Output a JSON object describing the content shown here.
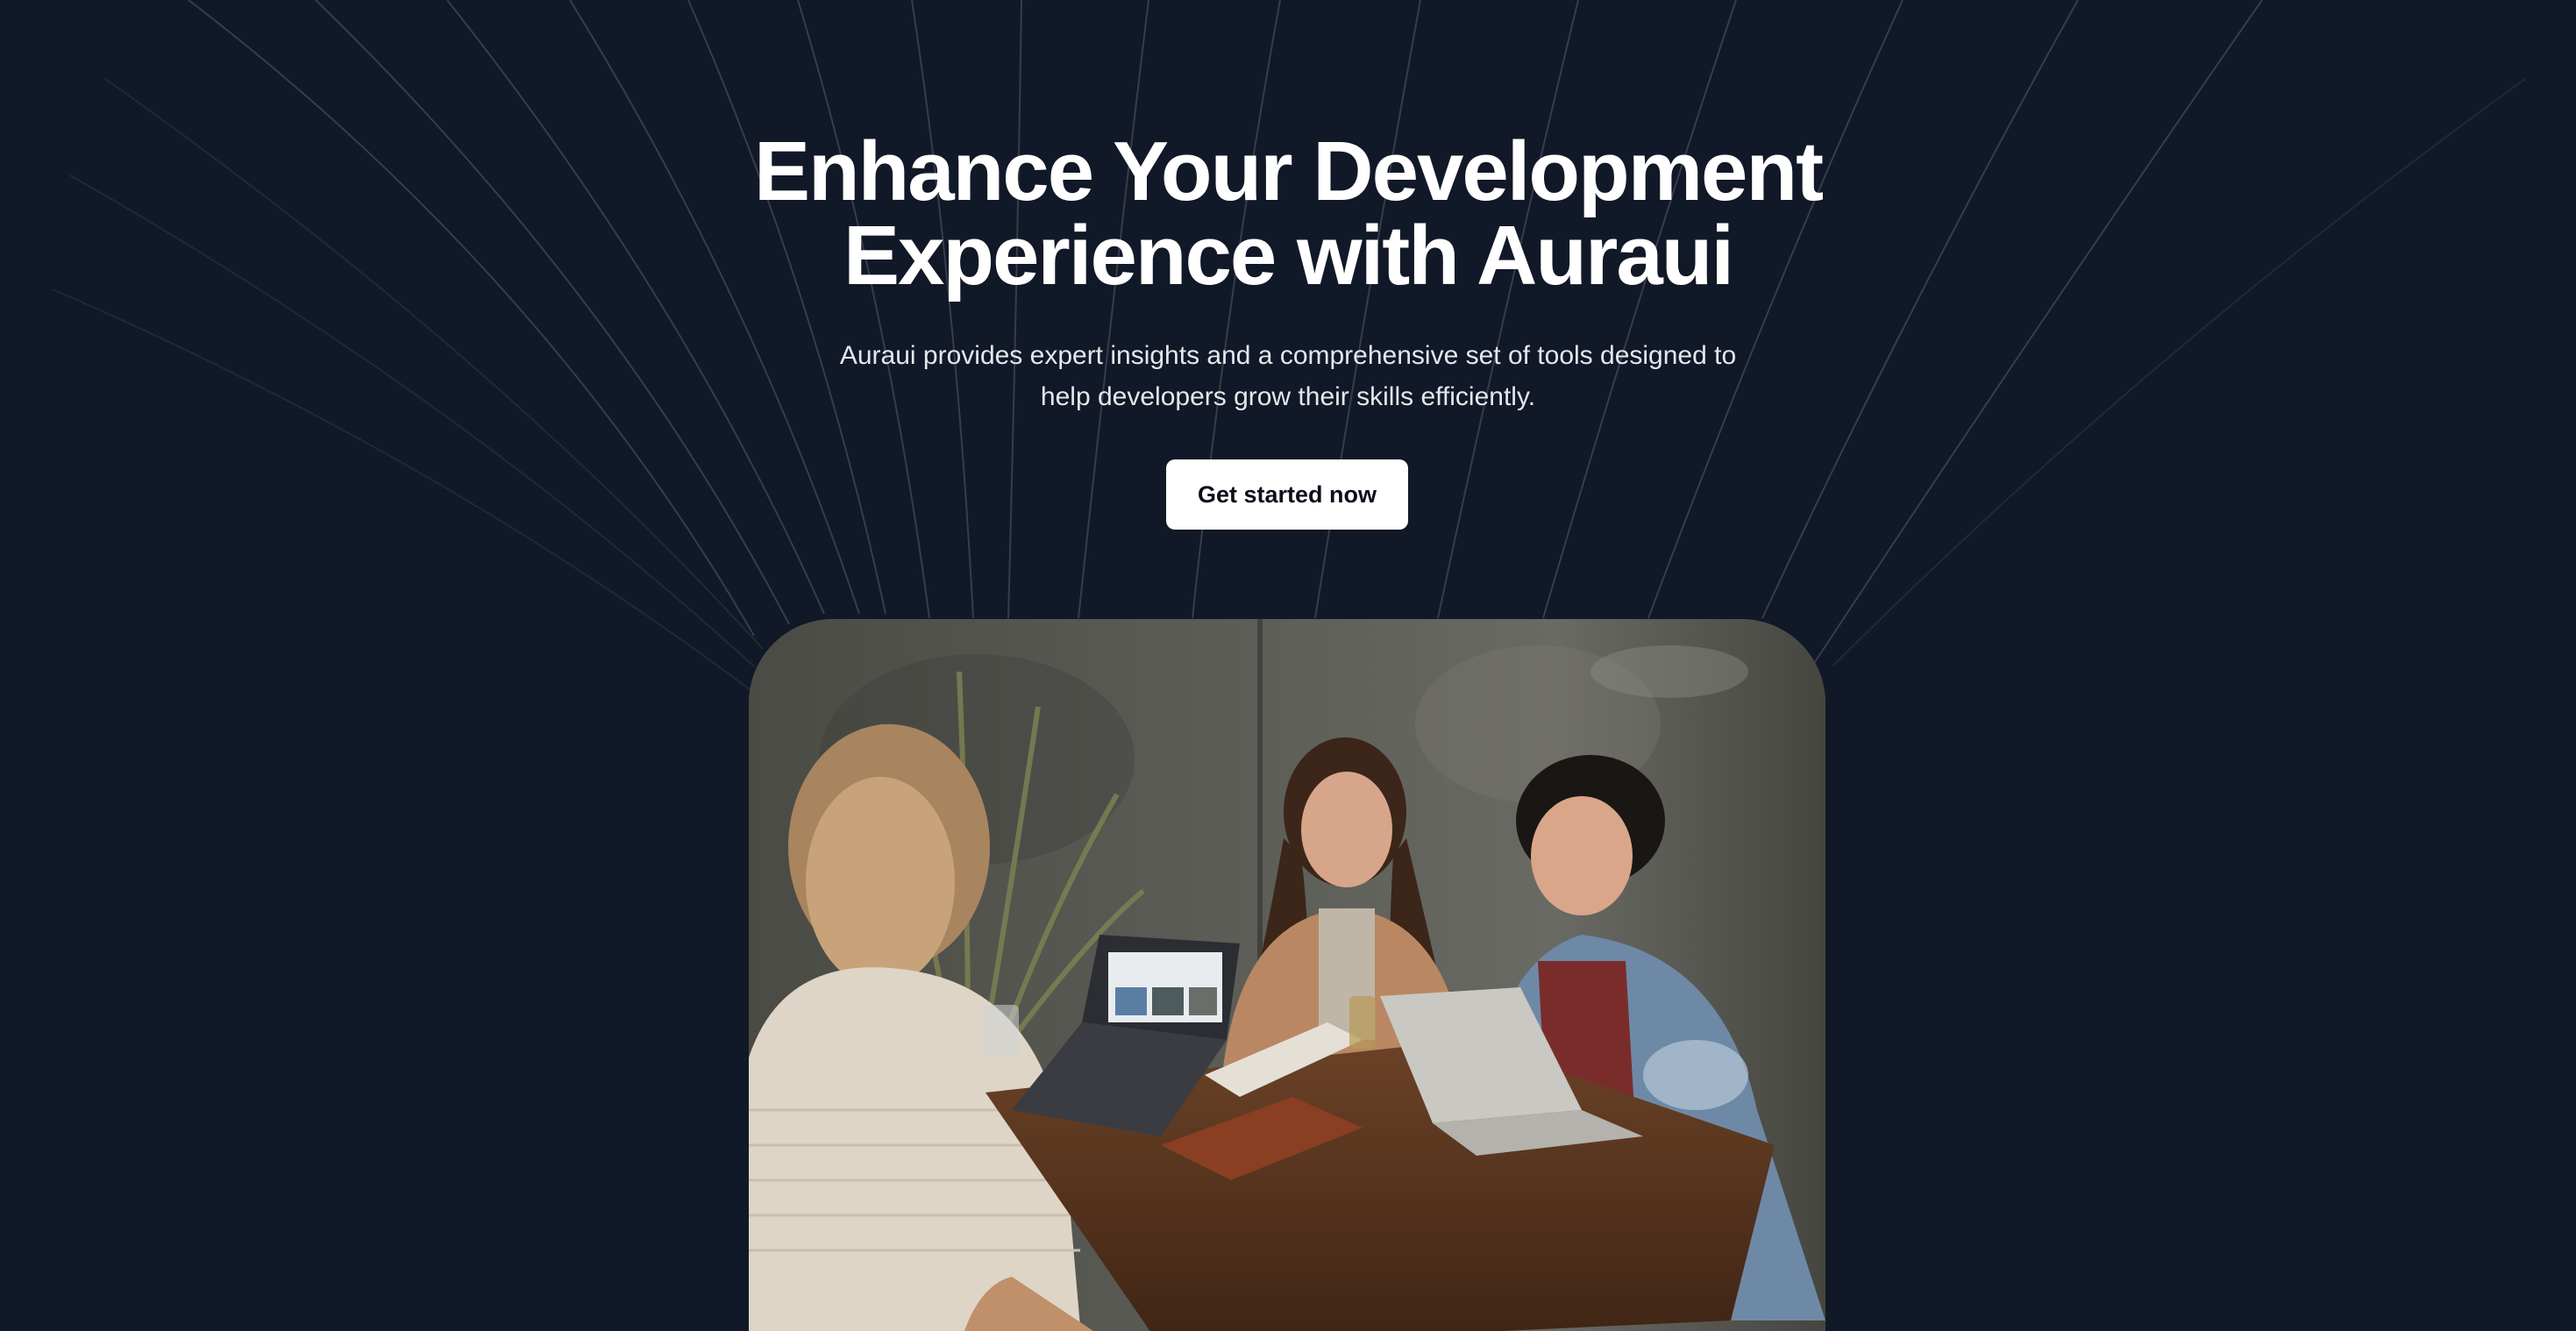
{
  "hero": {
    "title_line1": "Enhance Your Development",
    "title_line2": "Experience with Auraui",
    "subtitle_line1": "Auraui provides expert insights and a comprehensive set of tools designed to",
    "subtitle_line2": "help developers grow their skills efficiently.",
    "cta_label": "Get started now"
  },
  "colors": {
    "background": "#111827",
    "title": "#ffffff",
    "subtitle": "#e5e7eb",
    "button_bg": "#ffffff",
    "button_text": "#0b0f19"
  },
  "image": {
    "subject": "three people laughing around a wooden table with laptops"
  }
}
